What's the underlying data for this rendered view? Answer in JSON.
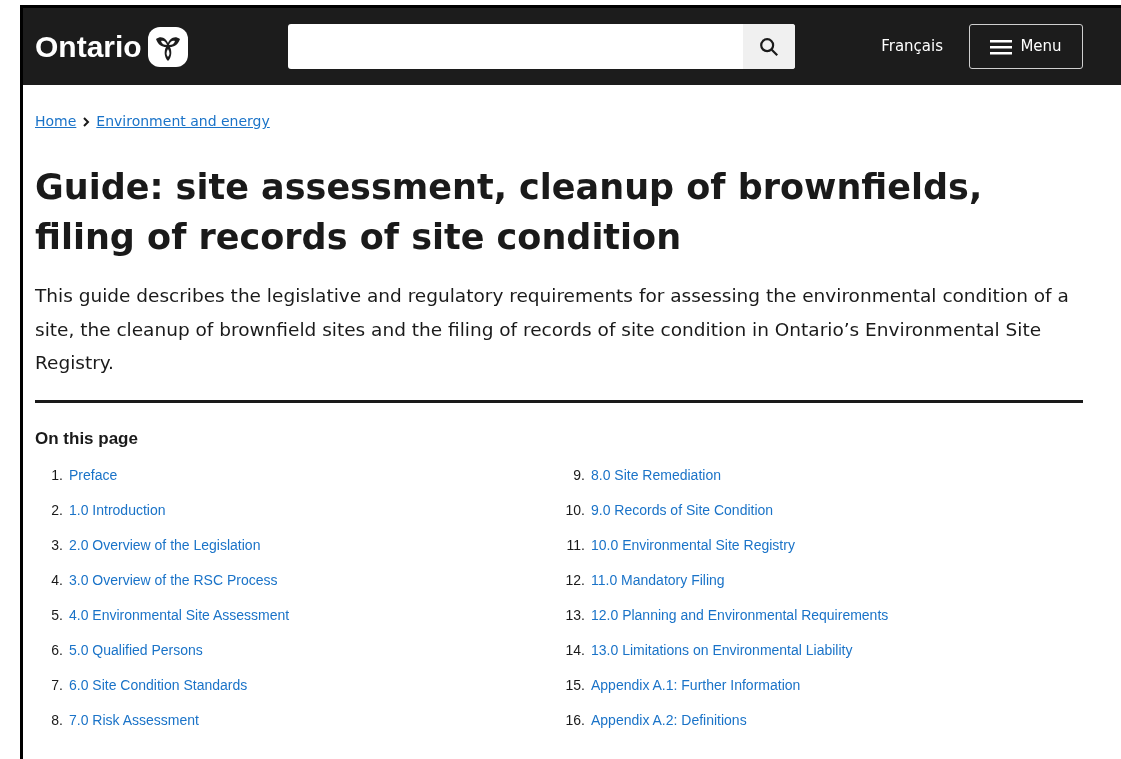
{
  "header": {
    "logo": "Ontario",
    "language_link": "Français",
    "menu_button": "Menu"
  },
  "breadcrumb": [
    "Home",
    "Environment and energy"
  ],
  "title": "Guide: site assessment, cleanup of brownfields, filing of records of site condition",
  "intro": "This guide describes the legislative and regulatory requirements for assessing the environmental condition of a site, the cleanup of brownfield sites and the filing of records of site condition in Ontario’s Environmental Site Registry.",
  "on_this_page": {
    "heading": "On this page",
    "columns": [
      [
        {
          "number": "1.",
          "label": "Preface"
        },
        {
          "number": "2.",
          "label": "1.0 Introduction"
        },
        {
          "number": "3.",
          "label": "2.0 Overview of the Legislation"
        },
        {
          "number": "4.",
          "label": "3.0 Overview of the RSC Process"
        },
        {
          "number": "5.",
          "label": "4.0 Environmental Site Assessment"
        },
        {
          "number": "6.",
          "label": "5.0 Qualified Persons"
        },
        {
          "number": "7.",
          "label": "6.0 Site Condition Standards"
        },
        {
          "number": "8.",
          "label": "7.0 Risk Assessment"
        }
      ],
      [
        {
          "number": "9.",
          "label": "8.0 Site Remediation"
        },
        {
          "number": "10.",
          "label": "9.0 Records of Site Condition"
        },
        {
          "number": "11.",
          "label": "10.0 Environmental Site Registry"
        },
        {
          "number": "12.",
          "label": "11.0 Mandatory Filing"
        },
        {
          "number": "13.",
          "label": "12.0 Planning and Environmental Requirements"
        },
        {
          "number": "14.",
          "label": "13.0 Limitations on Environmental Liability"
        },
        {
          "number": "15.",
          "label": "Appendix A.1: Further Information"
        },
        {
          "number": "16.",
          "label": "Appendix A.2: Definitions"
        }
      ]
    ]
  }
}
